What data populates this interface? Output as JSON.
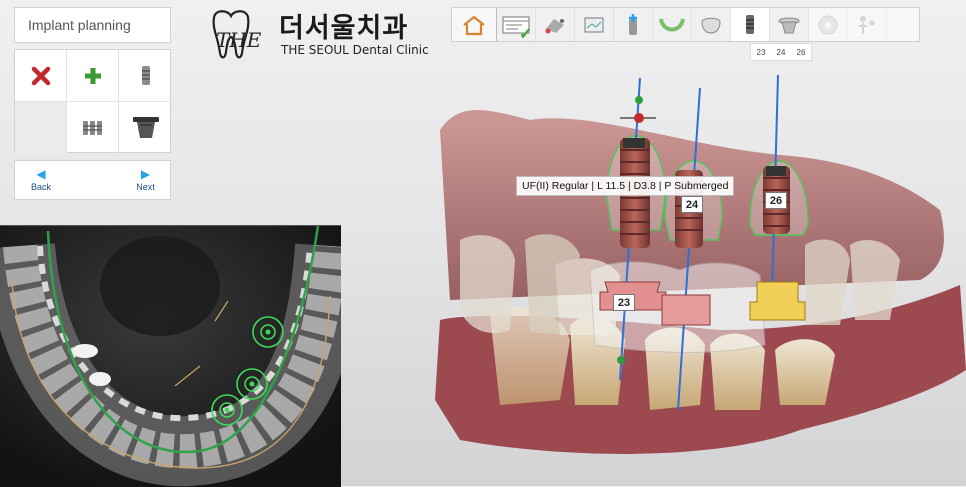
{
  "panel": {
    "title": "Implant planning",
    "tools": [
      {
        "icon": "delete-x-icon"
      },
      {
        "icon": "add-plus-icon"
      },
      {
        "icon": "implant-icon"
      },
      {
        "icon": ""
      },
      {
        "icon": "multi-implant-icon"
      },
      {
        "icon": "abutment-icon"
      }
    ],
    "nav": {
      "back": "Back",
      "next": "Next"
    }
  },
  "clinic": {
    "name_ko": "더서울치과",
    "name_en": "THE SEOUL Dental Clinic",
    "logo_text": "THE"
  },
  "workflow": {
    "steps": [
      {
        "icon": "home-icon",
        "state": "home"
      },
      {
        "icon": "patient-chart-icon",
        "state": "done"
      },
      {
        "icon": "scan-tools-icon",
        "state": "done"
      },
      {
        "icon": "image-icon",
        "state": "done"
      },
      {
        "icon": "implant-add-icon",
        "state": "done"
      },
      {
        "icon": "arch-icon",
        "state": "done"
      },
      {
        "icon": "crown-icon",
        "state": "done"
      },
      {
        "icon": "implant-icon",
        "state": "active"
      },
      {
        "icon": "abutment-icon",
        "state": "done"
      },
      {
        "icon": "disc-icon",
        "state": "todo"
      },
      {
        "icon": "guide-icon",
        "state": "todo"
      }
    ]
  },
  "tooth_tabs": [
    "23",
    "24",
    "26"
  ],
  "implant_info": "UF(II) Regular | L 11.5 | D3.8 | P Submerged",
  "implants": [
    {
      "number": "23",
      "label_number": "23"
    },
    {
      "number": "24",
      "label_number": "24"
    },
    {
      "number": "26",
      "label_number": "26"
    }
  ],
  "colors": {
    "accent": "#2aa2e6",
    "axis": "#2f6fd6",
    "guide_green": "#3bbf4a",
    "implant": "#a0524a",
    "check": "#3aaa35"
  }
}
